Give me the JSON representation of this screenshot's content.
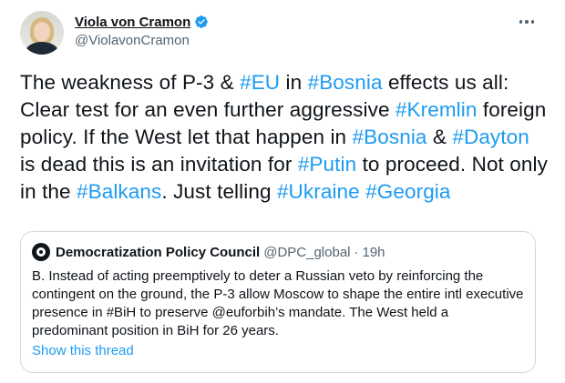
{
  "author": {
    "name": "Viola von Cramon",
    "handle": "@ViolavonCramon",
    "verified": true,
    "verified_color": "#1d9bf0"
  },
  "tweet": {
    "segments": [
      {
        "text": "The weakness of P-3 & ",
        "tag": false
      },
      {
        "text": "#EU",
        "tag": true
      },
      {
        "text": " in ",
        "tag": false
      },
      {
        "text": "#Bosnia",
        "tag": true
      },
      {
        "text": " effects us all: Clear test for an even further aggressive ",
        "tag": false
      },
      {
        "text": "#Kremlin",
        "tag": true
      },
      {
        "text": " foreign policy. If the West let that happen in ",
        "tag": false
      },
      {
        "text": "#Bosnia",
        "tag": true
      },
      {
        "text": " & ",
        "tag": false
      },
      {
        "text": "#Dayton",
        "tag": true
      },
      {
        "text": " is dead this is an invitation for ",
        "tag": false
      },
      {
        "text": "#Putin",
        "tag": true
      },
      {
        "text": " to proceed. Not only in the ",
        "tag": false
      },
      {
        "text": "#Balkans",
        "tag": true
      },
      {
        "text": ". Just telling ",
        "tag": false
      },
      {
        "text": "#Ukraine",
        "tag": true
      },
      {
        "text": " ",
        "tag": false
      },
      {
        "text": "#Georgia",
        "tag": true
      }
    ],
    "link_color": "#1d9bf0"
  },
  "quote": {
    "name": "Democratization Policy Council",
    "handle": "@DPC_global",
    "separator": "·",
    "time": "19h",
    "text": "B. Instead of acting preemptively to deter a Russian veto by reinforcing the contingent on the ground, the P-3 allow Moscow to shape the entire intl executive presence in #BiH to preserve @euforbih’s mandate. The West held a predominant position in BiH for 26 years.",
    "show_thread": "Show this thread"
  },
  "icons": {
    "more": "more-options-icon",
    "verified": "verified-badge-icon"
  }
}
